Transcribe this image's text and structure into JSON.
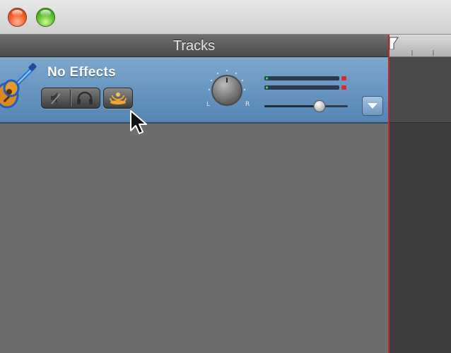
{
  "window": {
    "buttons": [
      "close-button",
      "zoom-button"
    ]
  },
  "tracks_panel": {
    "header_title": "Tracks"
  },
  "track": {
    "name": "No Effects",
    "instrument_icon": "acoustic-guitar-icon",
    "controls": {
      "mute_icon": "speaker-mute-icon",
      "solo_icon": "headphones-icon",
      "monitor_icon": "monitor-waves-icon",
      "pan_left_label": "L",
      "pan_right_label": "R",
      "volume_level": 0.66,
      "details_icon": "triangle-down-icon"
    }
  },
  "colors": {
    "track_header_blue": "#6a95bf",
    "playhead_red": "#c4262a",
    "monitor_orange": "#f0a534"
  }
}
